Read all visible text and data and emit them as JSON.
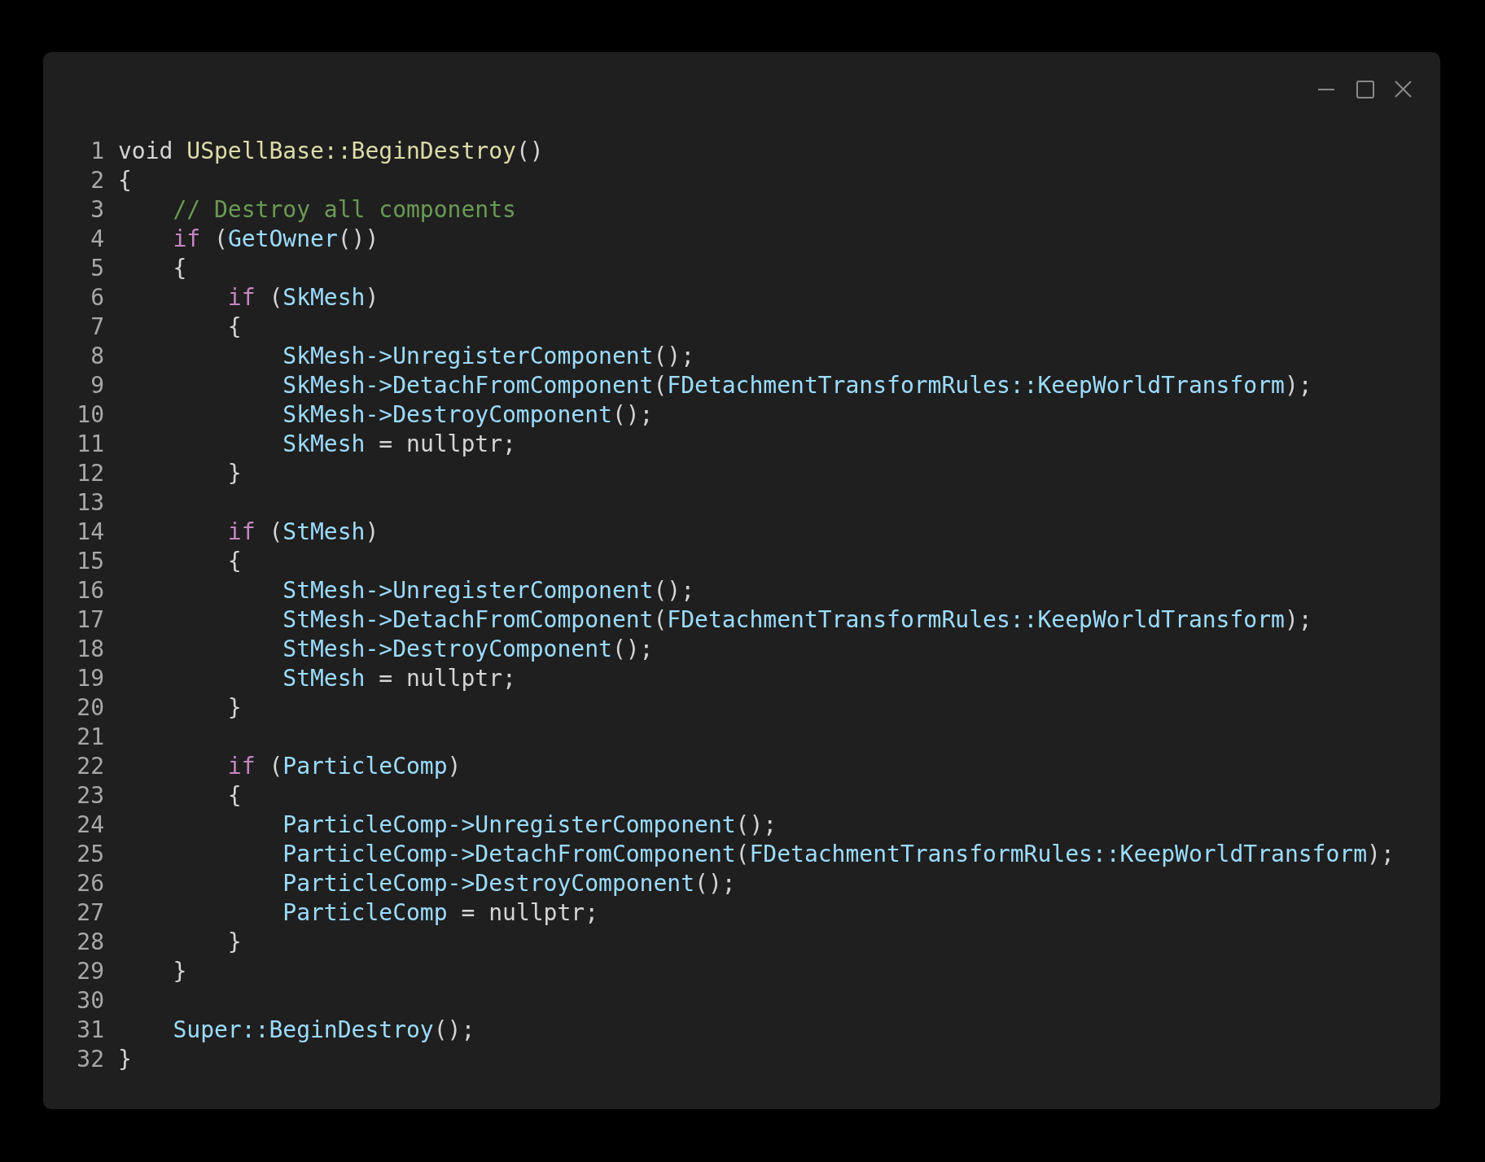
{
  "window": {
    "controls": [
      {
        "kind": "minimize"
      },
      {
        "kind": "maximize"
      },
      {
        "kind": "close"
      }
    ]
  },
  "code": {
    "lines": [
      {
        "number": "1",
        "tokens": [
          {
            "text": "void ",
            "kind": "plain"
          },
          {
            "text": "USpellBase::BeginDestroy",
            "kind": "function"
          },
          {
            "text": "()",
            "kind": "plain"
          }
        ]
      },
      {
        "number": "2",
        "tokens": [
          {
            "text": "{",
            "kind": "plain"
          }
        ]
      },
      {
        "number": "3",
        "tokens": [
          {
            "text": "    // Destroy all components",
            "kind": "comment"
          }
        ]
      },
      {
        "number": "4",
        "tokens": [
          {
            "text": "    if",
            "kind": "keyword"
          },
          {
            "text": " (",
            "kind": "plain"
          },
          {
            "text": "GetOwner",
            "kind": "variable"
          },
          {
            "text": "())",
            "kind": "plain"
          }
        ]
      },
      {
        "number": "5",
        "tokens": [
          {
            "text": "    {",
            "kind": "plain"
          }
        ]
      },
      {
        "number": "6",
        "tokens": [
          {
            "text": "        if",
            "kind": "keyword"
          },
          {
            "text": " (",
            "kind": "plain"
          },
          {
            "text": "SkMesh",
            "kind": "variable"
          },
          {
            "text": ")",
            "kind": "plain"
          }
        ]
      },
      {
        "number": "7",
        "tokens": [
          {
            "text": "        {",
            "kind": "plain"
          }
        ]
      },
      {
        "number": "8",
        "tokens": [
          {
            "text": "            SkMesh->UnregisterComponent",
            "kind": "variable"
          },
          {
            "text": "();",
            "kind": "plain"
          }
        ]
      },
      {
        "number": "9",
        "tokens": [
          {
            "text": "            SkMesh->DetachFromComponent",
            "kind": "variable"
          },
          {
            "text": "(",
            "kind": "plain"
          },
          {
            "text": "FDetachmentTransformRules::KeepWorldTransform",
            "kind": "variable"
          },
          {
            "text": ");",
            "kind": "plain"
          }
        ]
      },
      {
        "number": "10",
        "tokens": [
          {
            "text": "            SkMesh->DestroyComponent",
            "kind": "variable"
          },
          {
            "text": "();",
            "kind": "plain"
          }
        ]
      },
      {
        "number": "11",
        "tokens": [
          {
            "text": "            SkMesh",
            "kind": "variable"
          },
          {
            "text": " = nullptr;",
            "kind": "plain"
          }
        ]
      },
      {
        "number": "12",
        "tokens": [
          {
            "text": "        }",
            "kind": "plain"
          }
        ]
      },
      {
        "number": "13"
      },
      {
        "number": "14",
        "tokens": [
          {
            "text": "        if",
            "kind": "keyword"
          },
          {
            "text": " (",
            "kind": "plain"
          },
          {
            "text": "StMesh",
            "kind": "variable"
          },
          {
            "text": ")",
            "kind": "plain"
          }
        ]
      },
      {
        "number": "15",
        "tokens": [
          {
            "text": "        {",
            "kind": "plain"
          }
        ]
      },
      {
        "number": "16",
        "tokens": [
          {
            "text": "            StMesh->UnregisterComponent",
            "kind": "variable"
          },
          {
            "text": "();",
            "kind": "plain"
          }
        ]
      },
      {
        "number": "17",
        "tokens": [
          {
            "text": "            StMesh->DetachFromComponent",
            "kind": "variable"
          },
          {
            "text": "(",
            "kind": "plain"
          },
          {
            "text": "FDetachmentTransformRules::KeepWorldTransform",
            "kind": "variable"
          },
          {
            "text": ");",
            "kind": "plain"
          }
        ]
      },
      {
        "number": "18",
        "tokens": [
          {
            "text": "            StMesh->DestroyComponent",
            "kind": "variable"
          },
          {
            "text": "();",
            "kind": "plain"
          }
        ]
      },
      {
        "number": "19",
        "tokens": [
          {
            "text": "            StMesh",
            "kind": "variable"
          },
          {
            "text": " = nullptr;",
            "kind": "plain"
          }
        ]
      },
      {
        "number": "20",
        "tokens": [
          {
            "text": "        }",
            "kind": "plain"
          }
        ]
      },
      {
        "number": "21"
      },
      {
        "number": "22",
        "tokens": [
          {
            "text": "        if",
            "kind": "keyword"
          },
          {
            "text": " (",
            "kind": "plain"
          },
          {
            "text": "ParticleComp",
            "kind": "variable"
          },
          {
            "text": ")",
            "kind": "plain"
          }
        ]
      },
      {
        "number": "23",
        "tokens": [
          {
            "text": "        {",
            "kind": "plain"
          }
        ]
      },
      {
        "number": "24",
        "tokens": [
          {
            "text": "            ParticleComp->UnregisterComponent",
            "kind": "variable"
          },
          {
            "text": "();",
            "kind": "plain"
          }
        ]
      },
      {
        "number": "25",
        "tokens": [
          {
            "text": "            ParticleComp->DetachFromComponent",
            "kind": "variable"
          },
          {
            "text": "(",
            "kind": "plain"
          },
          {
            "text": "FDetachmentTransformRules::KeepWorldTransform",
            "kind": "variable"
          },
          {
            "text": ");",
            "kind": "plain"
          }
        ]
      },
      {
        "number": "26",
        "tokens": [
          {
            "text": "            ParticleComp->DestroyComponent",
            "kind": "variable"
          },
          {
            "text": "();",
            "kind": "plain"
          }
        ]
      },
      {
        "number": "27",
        "tokens": [
          {
            "text": "            ParticleComp",
            "kind": "variable"
          },
          {
            "text": " = nullptr;",
            "kind": "plain"
          }
        ]
      },
      {
        "number": "28",
        "tokens": [
          {
            "text": "        }",
            "kind": "plain"
          }
        ]
      },
      {
        "number": "29",
        "tokens": [
          {
            "text": "    }",
            "kind": "plain"
          }
        ]
      },
      {
        "number": "30"
      },
      {
        "number": "31",
        "tokens": [
          {
            "text": "    Super::BeginDestroy",
            "kind": "variable"
          },
          {
            "text": "();",
            "kind": "plain"
          }
        ]
      },
      {
        "number": "32",
        "tokens": [
          {
            "text": "}",
            "kind": "plain"
          }
        ]
      }
    ]
  }
}
